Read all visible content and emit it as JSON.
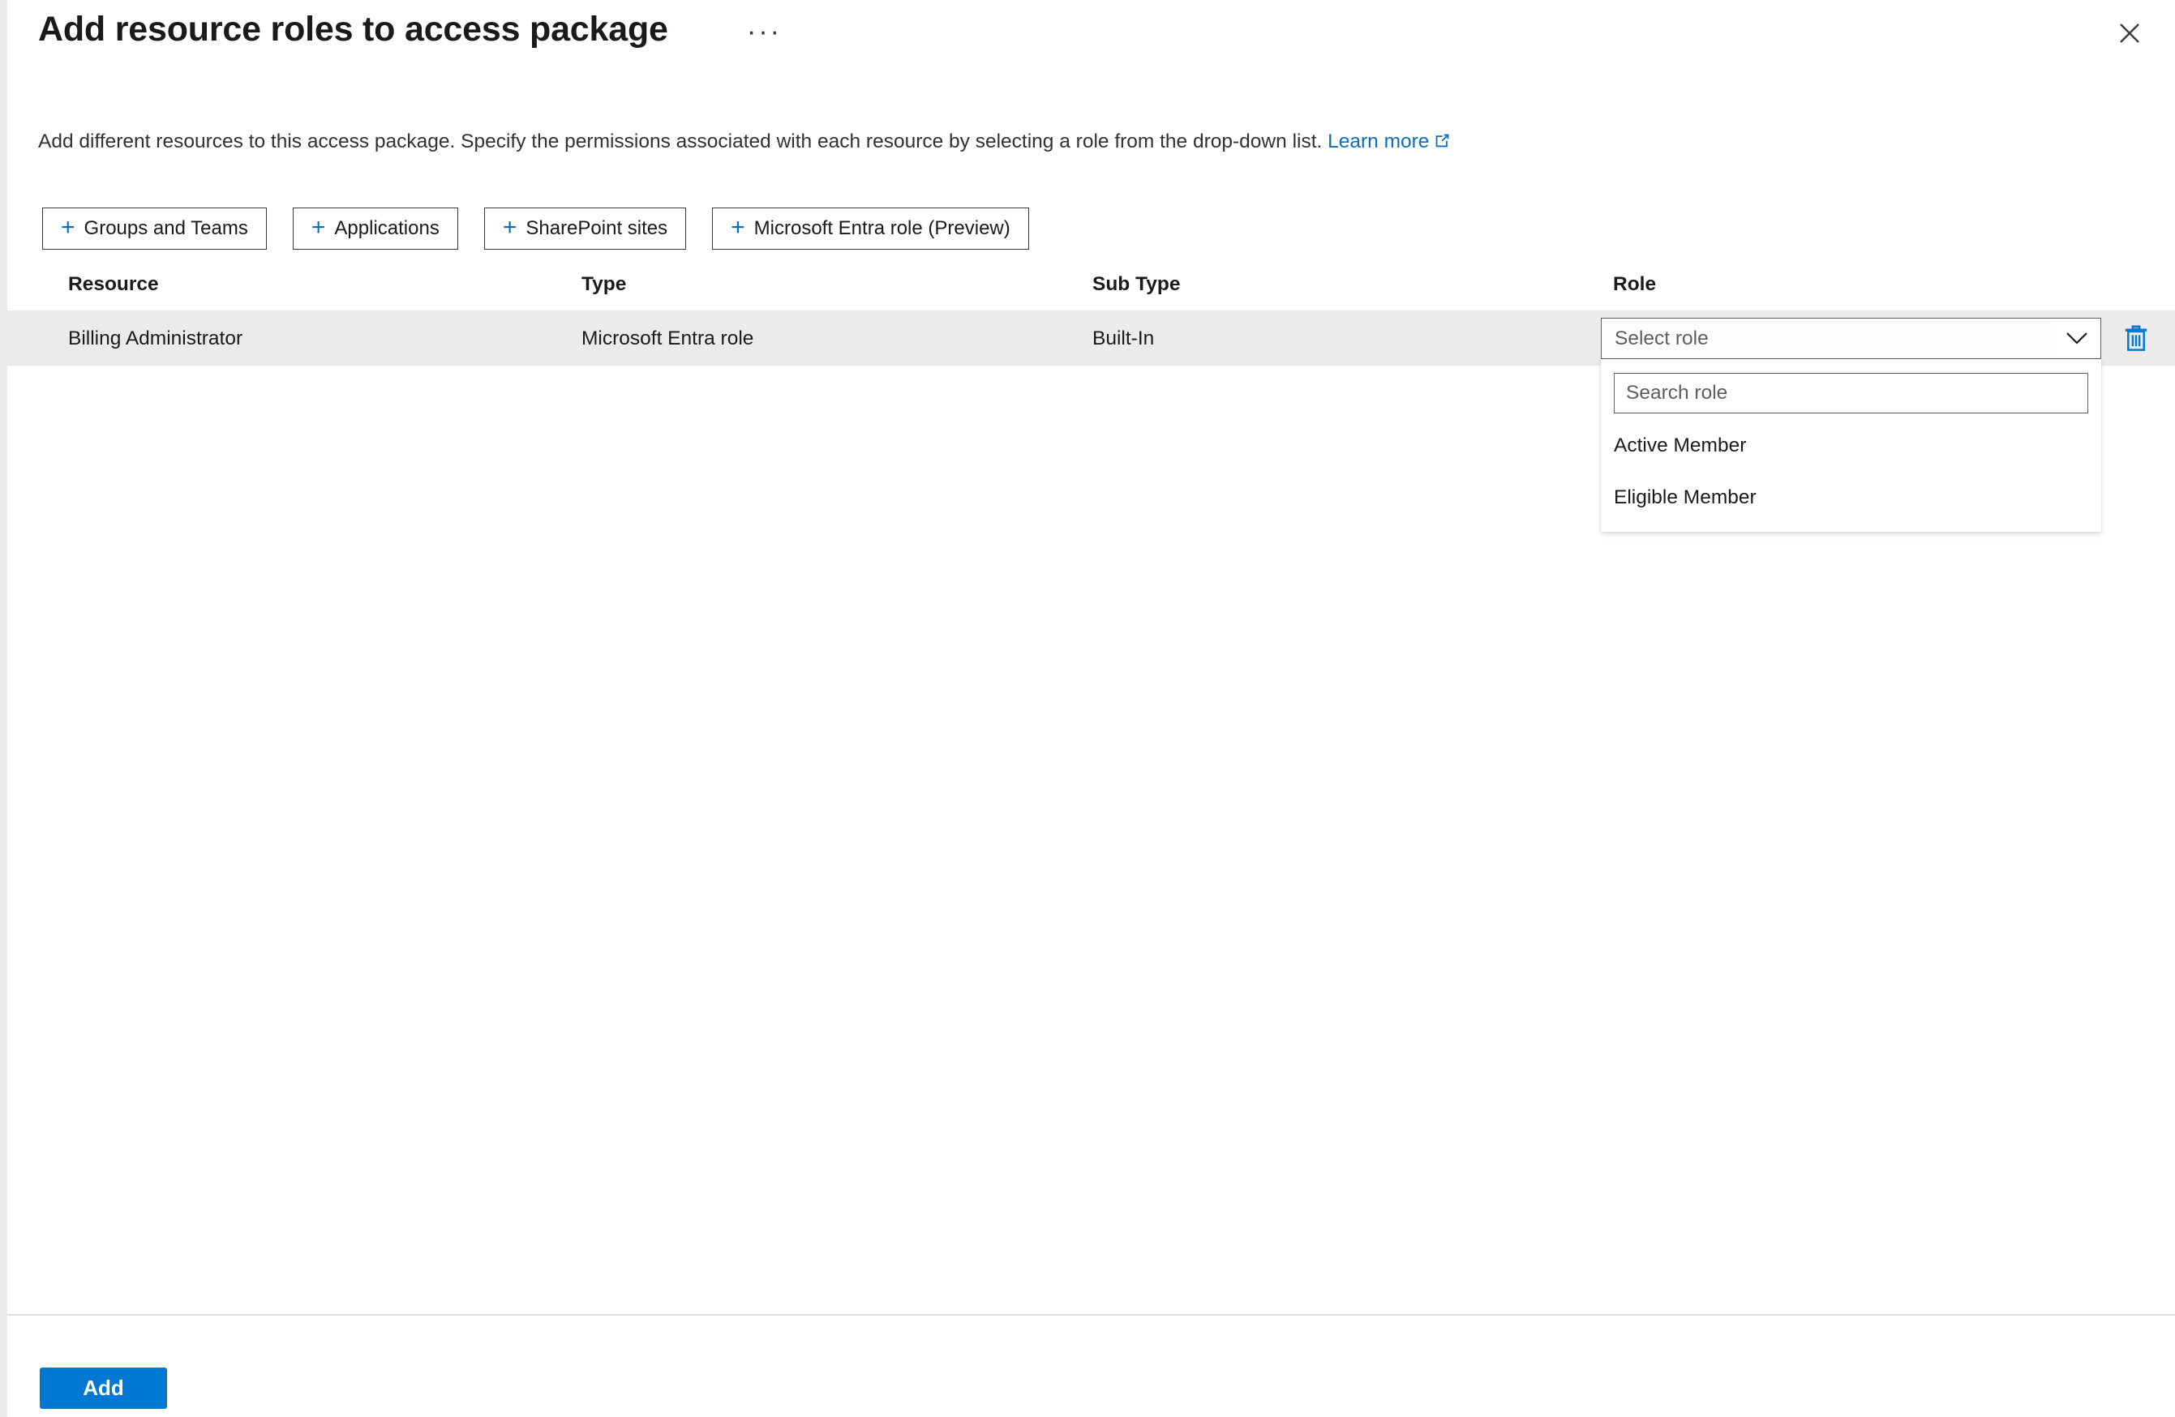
{
  "header": {
    "title": "Add resource roles to access package",
    "ellipsis_label": "···",
    "close_icon": "close-icon"
  },
  "description": {
    "text": "Add different resources to this access package. Specify the permissions associated with each resource by selecting a role from the drop-down list.",
    "link_label": "Learn more",
    "link_icon": "external-link-icon"
  },
  "command_bar": {
    "plus_glyph": "+",
    "buttons": [
      {
        "label": "Groups and Teams"
      },
      {
        "label": "Applications"
      },
      {
        "label": "SharePoint sites"
      },
      {
        "label": "Microsoft Entra role (Preview)"
      }
    ]
  },
  "table": {
    "columns": [
      {
        "label": "Resource"
      },
      {
        "label": "Type"
      },
      {
        "label": "Sub Type"
      },
      {
        "label": "Role"
      }
    ],
    "rows": [
      {
        "resource": "Billing Administrator",
        "type": "Microsoft Entra role",
        "sub_type": "Built-In",
        "role": {
          "selected_text": "Select role",
          "chevron_icon": "chevron-down-icon",
          "expanded": true,
          "search_placeholder": "Search role",
          "search_value": "",
          "options": [
            {
              "label": "Active Member"
            },
            {
              "label": "Eligible Member"
            }
          ]
        },
        "delete_icon": "trash-icon"
      }
    ]
  },
  "footer": {
    "add_label": "Add"
  },
  "colors": {
    "accent": "#0078d4",
    "link": "#0f6cbd",
    "row_background": "#eceaea",
    "border": "#605e5c",
    "button_border": "#3b3a39",
    "divider": "#e1dfdd",
    "text": "#1b1a19",
    "muted_text": "#605e5c"
  }
}
